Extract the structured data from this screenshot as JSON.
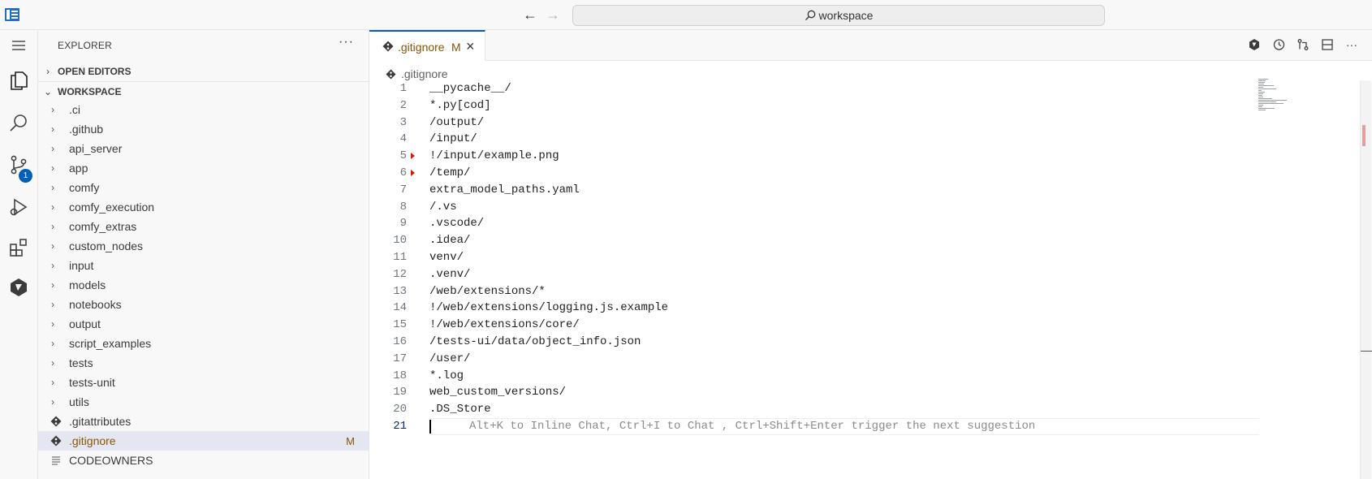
{
  "titlebar": {
    "search_text": "workspace"
  },
  "activity": {
    "scm_badge": "1"
  },
  "sidebar": {
    "title": "EXPLORER",
    "more": "···",
    "open_editors": "OPEN EDITORS",
    "workspace": "WORKSPACE",
    "folders": [
      ".ci",
      ".github",
      "api_server",
      "app",
      "comfy",
      "comfy_execution",
      "comfy_extras",
      "custom_nodes",
      "input",
      "models",
      "notebooks",
      "output",
      "script_examples",
      "tests",
      "tests-unit",
      "utils"
    ],
    "files": [
      {
        "name": ".gitattributes",
        "icon": "git-file-icon",
        "status": ""
      },
      {
        "name": ".gitignore",
        "icon": "git-file-icon",
        "status": "M"
      },
      {
        "name": "CODEOWNERS",
        "icon": "text-file-icon",
        "status": ""
      }
    ]
  },
  "editor": {
    "tab_label": ".gitignore",
    "tab_status": "M",
    "breadcrumb": ".gitignore",
    "lines": [
      "__pycache__/",
      "*.py[cod]",
      "/output/",
      "/input/",
      "!/input/example.png",
      "/temp/",
      "extra_model_paths.yaml",
      "/.vs",
      ".vscode/",
      ".idea/",
      "venv/",
      ".venv/",
      "/web/extensions/*",
      "!/web/extensions/logging.js.example",
      "!/web/extensions/core/",
      "/tests-ui/data/object_info.json",
      "/user/",
      "*.log",
      "web_custom_versions/",
      ".DS_Store",
      ""
    ],
    "line_numbers": [
      "1",
      "2",
      "3",
      "4",
      "5",
      "6",
      "7",
      "8",
      "9",
      "10",
      "11",
      "12",
      "13",
      "14",
      "15",
      "16",
      "17",
      "18",
      "19",
      "20",
      "21"
    ],
    "ghost_text": "Alt+K to Inline Chat, Ctrl+I to Chat , Ctrl+Shift+Enter trigger the next suggestion",
    "current_line": 21
  },
  "colors": {
    "accent": "#005fb8",
    "modified": "#895503",
    "selection": "#e4e6f1"
  }
}
